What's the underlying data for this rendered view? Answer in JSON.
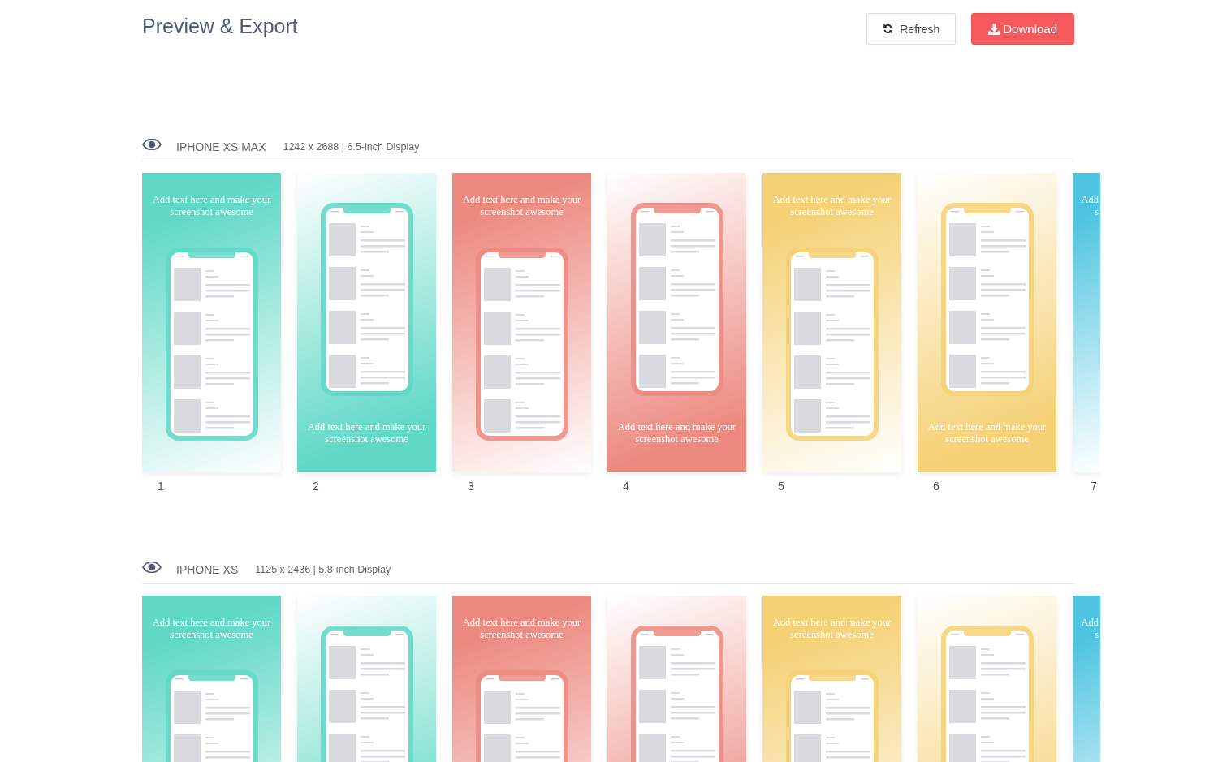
{
  "header": {
    "title": "Preview & Export",
    "buttons": [
      {
        "kind": "refresh",
        "label": "Refresh"
      },
      {
        "kind": "download",
        "label": "Download"
      }
    ]
  },
  "sections": [
    {
      "device": "IPHONE XS MAX",
      "spec": "1242 x 2688 | 6.5-inch Display",
      "cards": [
        {
          "kind": "top",
          "color": "#5fd8c6",
          "caption": "Add text here and make your screenshot awesome",
          "number": "1"
        },
        {
          "kind": "bottom",
          "color": "#5fd8c6",
          "caption": "Add text here and make your screenshot awesome",
          "number": "2"
        },
        {
          "kind": "top",
          "color": "#ec8a80",
          "caption": "Add text here and make your screenshot awesome",
          "number": "3"
        },
        {
          "kind": "bottom",
          "color": "#ec8a80",
          "caption": "Add text here and make your screenshot awesome",
          "number": "4"
        },
        {
          "kind": "top",
          "color": "#f5d175",
          "caption": "Add text here and make your screenshot awesome",
          "number": "5"
        },
        {
          "kind": "bottom",
          "color": "#f5d175",
          "caption": "Add text here and make your screenshot awesome",
          "number": "6"
        },
        {
          "kind": "top",
          "color": "#4ec4e0",
          "caption": "Add\ns",
          "number": "7"
        }
      ]
    },
    {
      "device": "IPHONE XS",
      "spec": "1125 x 2436 | 5.8-inch Display",
      "cards": [
        {
          "kind": "top",
          "color": "#5fd8c6",
          "caption": "Add text here and make your screenshot awesome"
        },
        {
          "kind": "bottom",
          "color": "#5fd8c6"
        },
        {
          "kind": "top",
          "color": "#ec8a80",
          "caption": "Add text here and make your screenshot awesome"
        },
        {
          "kind": "bottom",
          "color": "#ec8a80"
        },
        {
          "kind": "top",
          "color": "#f5d175",
          "caption": "Add text here and make your screenshot awesome"
        },
        {
          "kind": "bottom",
          "color": "#f5d175"
        },
        {
          "kind": "top",
          "color": "#4ec4e0",
          "caption": "Add\ns"
        }
      ]
    }
  ]
}
